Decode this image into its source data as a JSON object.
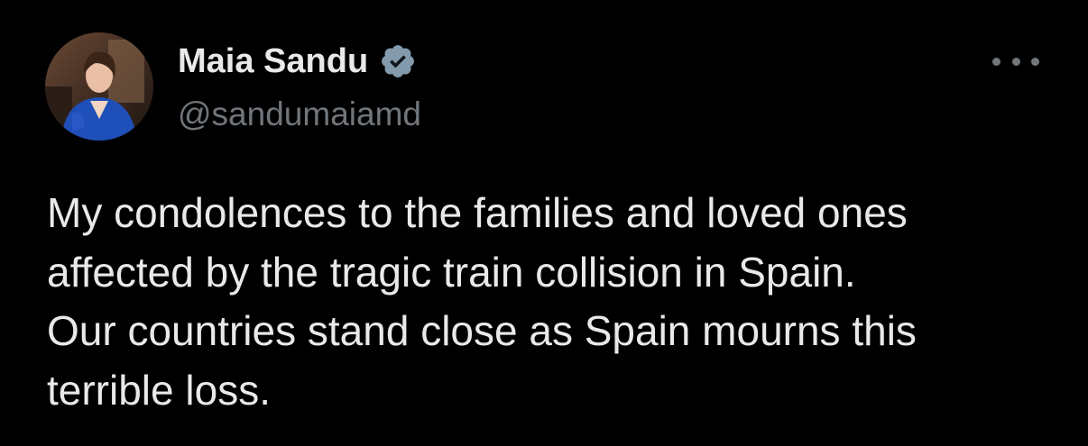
{
  "author": {
    "display_name": "Maia Sandu",
    "handle": "@sandumaiamd",
    "verified": true,
    "avatar_icon": "profile-photo"
  },
  "post": {
    "lines": [
      "My condolences to the families and loved ones",
      "affected by the tragic train collision in Spain.",
      "Our countries stand close as Spain mourns this",
      "terrible loss."
    ]
  },
  "icons": {
    "verified": "verified-badge-icon",
    "more": "more-options-icon"
  },
  "colors": {
    "background": "#000000",
    "primary_text": "#e7e9ea",
    "secondary_text": "#71767b",
    "verified_badge": "#829aab"
  }
}
